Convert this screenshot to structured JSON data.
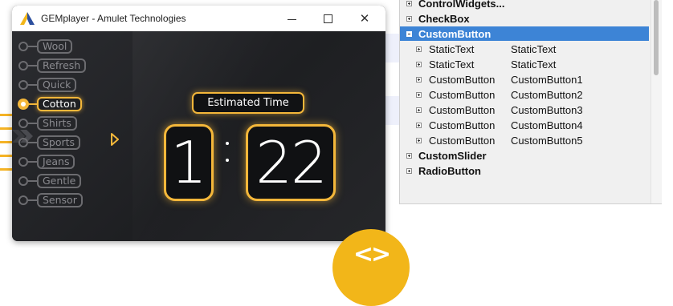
{
  "window": {
    "title": "GEMplayer - Amulet Technologies",
    "controls": {
      "minimize": "minimize",
      "maximize": "maximize",
      "close": "✕"
    }
  },
  "cycles": [
    "Wool",
    "Refresh",
    "Quick",
    "Cotton",
    "Shirts",
    "Sports",
    "Jeans",
    "Gentle",
    "Sensor"
  ],
  "selected_cycle": "Cotton",
  "timer": {
    "label": "Estimated Time",
    "minutes": "1",
    "seconds": "22"
  },
  "tree": {
    "rows_top": [
      {
        "label": "ControlWidgets..."
      },
      {
        "label": "CheckBox"
      },
      {
        "label": "CustomButton"
      }
    ],
    "children": [
      {
        "type": "StaticText",
        "name": "StaticText"
      },
      {
        "type": "StaticText",
        "name": "StaticText"
      },
      {
        "type": "CustomButton",
        "name": "CustomButton1"
      },
      {
        "type": "CustomButton",
        "name": "CustomButton2"
      },
      {
        "type": "CustomButton",
        "name": "CustomButton3"
      },
      {
        "type": "CustomButton",
        "name": "CustomButton4"
      },
      {
        "type": "CustomButton",
        "name": "CustomButton5"
      }
    ],
    "rows_bottom": [
      {
        "label": "CustomSlider"
      },
      {
        "label": "RadioButton"
      }
    ]
  },
  "badge": {
    "symbol": "<>"
  },
  "colors": {
    "accent": "#f4b73a",
    "selection": "#3d84d6",
    "badge": "#f2b619"
  }
}
